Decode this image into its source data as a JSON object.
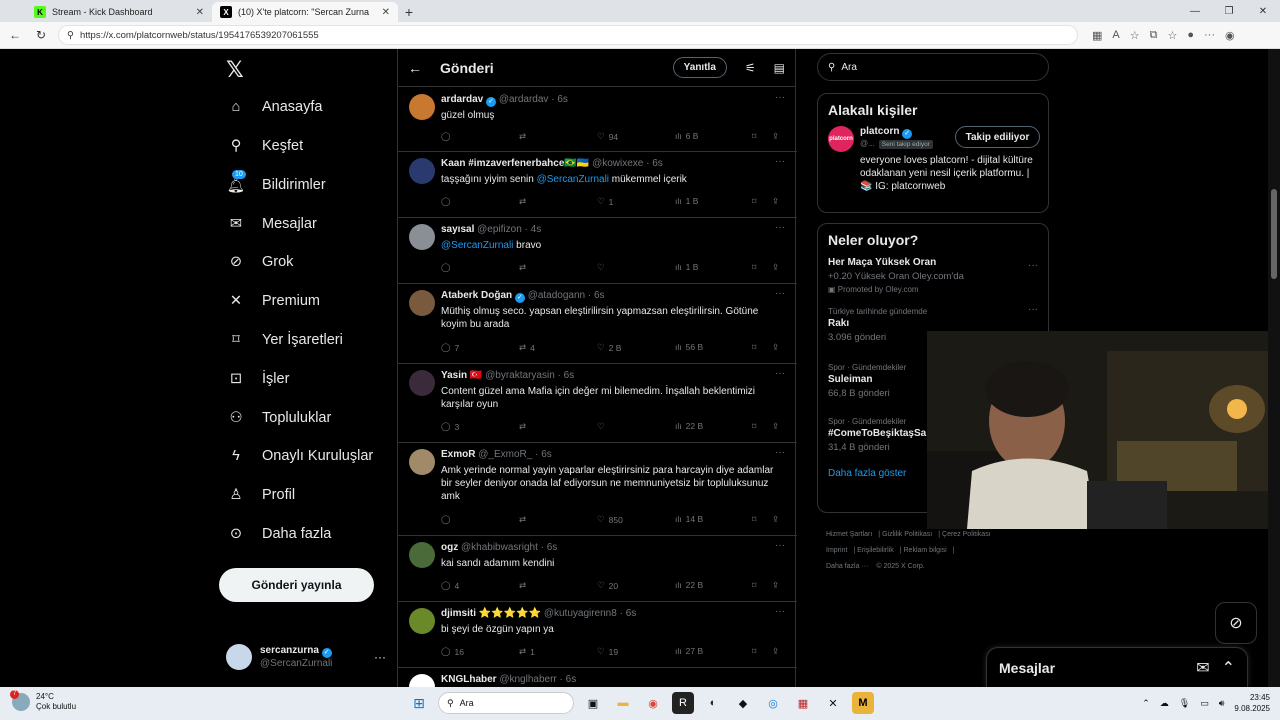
{
  "browser": {
    "tabs": [
      {
        "title": "Stream - Kick Dashboard",
        "fav": "K",
        "fav_color": "#53fc18"
      },
      {
        "title": "(10) X'te platcorn: \"Sercan Zurna",
        "fav": "X",
        "fav_color": "#000000"
      }
    ],
    "url": "https://x.com/platcornweb/status/1954176539207061555"
  },
  "nav": {
    "items": [
      {
        "label": "Anasayfa",
        "icon": "home-icon"
      },
      {
        "label": "Keşfet",
        "icon": "search-icon"
      },
      {
        "label": "Bildirimler",
        "icon": "bell-icon",
        "badge": "10"
      },
      {
        "label": "Mesajlar",
        "icon": "mail-icon"
      },
      {
        "label": "Grok",
        "icon": "grok-icon"
      },
      {
        "label": "Premium",
        "icon": "x-icon"
      },
      {
        "label": "Yer İşaretleri",
        "icon": "bookmark-icon"
      },
      {
        "label": "İşler",
        "icon": "briefcase-icon"
      },
      {
        "label": "Topluluklar",
        "icon": "people-icon"
      },
      {
        "label": "Onaylı Kuruluşlar",
        "icon": "lightning-icon"
      },
      {
        "label": "Profil",
        "icon": "person-icon"
      },
      {
        "label": "Daha fazla",
        "icon": "more-circle-icon"
      }
    ],
    "post_button": "Gönderi yayınla",
    "account": {
      "name": "sercanzurna",
      "handle": "@SercanZurnali"
    }
  },
  "main": {
    "title": "Gönderi",
    "reply_button": "Yanıtla",
    "tweets": [
      {
        "name": "ardardav",
        "verified": true,
        "handle": "@ardardav",
        "time": "6s",
        "text": "güzel olmuş",
        "mention": "",
        "replies": "",
        "retweets": "",
        "likes": "94",
        "views": "6 B"
      },
      {
        "name": "Kaan #imzaverfenerbahce🇧🇷🇺🇦",
        "verified": false,
        "handle": "@kowixexe",
        "time": "6s",
        "text_pre": "taşşağını yiyim senin ",
        "mention": "@SercanZurnali",
        "text_post": " mükemmel içerik",
        "replies": "",
        "retweets": "",
        "likes": "1",
        "views": "1 B"
      },
      {
        "name": "sayısal",
        "verified": false,
        "handle": "@epifizon",
        "time": "4s",
        "text_pre": "",
        "mention": "@SercanZurnali",
        "text_post": " bravo",
        "replies": "",
        "retweets": "",
        "likes": "",
        "views": "1 B"
      },
      {
        "name": "Ataberk Doğan",
        "verified": true,
        "handle": "@atadogann",
        "time": "6s",
        "text": "Müthiş olmuş seco. yapsan eleştirilirsin yapmazsan eleştirilirsin. Götüne koyim bu arada",
        "replies": "7",
        "retweets": "4",
        "likes": "2 B",
        "views": "56 B"
      },
      {
        "name": "Yasin 🇹🇷",
        "verified": false,
        "handle": "@byraktaryasin",
        "time": "6s",
        "text": "Content güzel ama Mafia için değer mi bilemedim. İnşallah beklentimizi karşılar oyun",
        "replies": "3",
        "retweets": "",
        "likes": "",
        "views": "22 B"
      },
      {
        "name": "ExmoR",
        "verified": false,
        "handle": "@_ExmoR_",
        "time": "6s",
        "text": "Amk yerinde normal yayin yaparlar eleştirirsiniz para harcayin diye adamlar bir seyler deniyor onada laf ediyorsun ne memnuniyetsiz bir topluluksunuz amk",
        "replies": "",
        "retweets": "",
        "likes": "850",
        "views": "14 B"
      },
      {
        "name": "ogz",
        "verified": false,
        "handle": "@khabibwasright",
        "time": "6s",
        "text": "kai sandı adamım kendini",
        "replies": "4",
        "retweets": "",
        "likes": "20",
        "views": "22 B"
      },
      {
        "name": "djimsiti ⭐⭐⭐⭐⭐",
        "verified": false,
        "handle": "@kutuyagirenn8",
        "time": "6s",
        "text": "bi şeyi de özgün yapın ya",
        "replies": "16",
        "retweets": "1",
        "likes": "19",
        "views": "27 B"
      },
      {
        "name": "KNGLhaber",
        "verified": false,
        "handle": "@knglhaberr",
        "time": "6s",
        "text": "",
        "replies": "",
        "retweets": "",
        "likes": "",
        "views": ""
      }
    ]
  },
  "right": {
    "search_placeholder": "Ara",
    "related_title": "Alakalı kişiler",
    "person": {
      "name": "platcorn",
      "handle": "@...",
      "follows_you": "Seni takip ediyor",
      "follow_button": "Takip ediliyor",
      "bio": "everyone loves platcorn! - dijital kültüre odaklanan yeni nesil içerik platformu. | 📚 IG: platcornweb",
      "avatar_text": "platcorn"
    },
    "trends_title": "Neler oluyor?",
    "trends": [
      {
        "cat": "",
        "name": "Her Maça Yüksek Oran",
        "sub": "+0.20 Yüksek Oran Oley.com'da",
        "promo": "Promoted by Oley.com"
      },
      {
        "cat": "Türkiye tarihinde gündemde",
        "name": "Rakı",
        "sub": "3.096 gönderi"
      },
      {
        "cat": "Spor · Gündemdekiler",
        "name": "Suleiman",
        "sub": "66,8 B gönderi"
      },
      {
        "cat": "Spor · Gündemdekiler",
        "name": "#ComeToBeşiktaşSa",
        "sub": "31,4 B gönderi"
      }
    ],
    "show_more": "Daha fazla göster",
    "footer": [
      "Hizmet Şartları",
      "Gizlilik Politikası",
      "Çerez Politikası",
      "Imprint",
      "Erişilebilirlik",
      "Reklam bilgisi",
      "Daha fazla ···",
      "© 2025 X Corp."
    ]
  },
  "dm": {
    "title": "Mesajlar"
  },
  "taskbar": {
    "temp": "24°C",
    "weather": "Çok bulutlu",
    "weather_badge": "7",
    "search": "Ara",
    "time": "23:45",
    "date": "9.08.2025"
  }
}
